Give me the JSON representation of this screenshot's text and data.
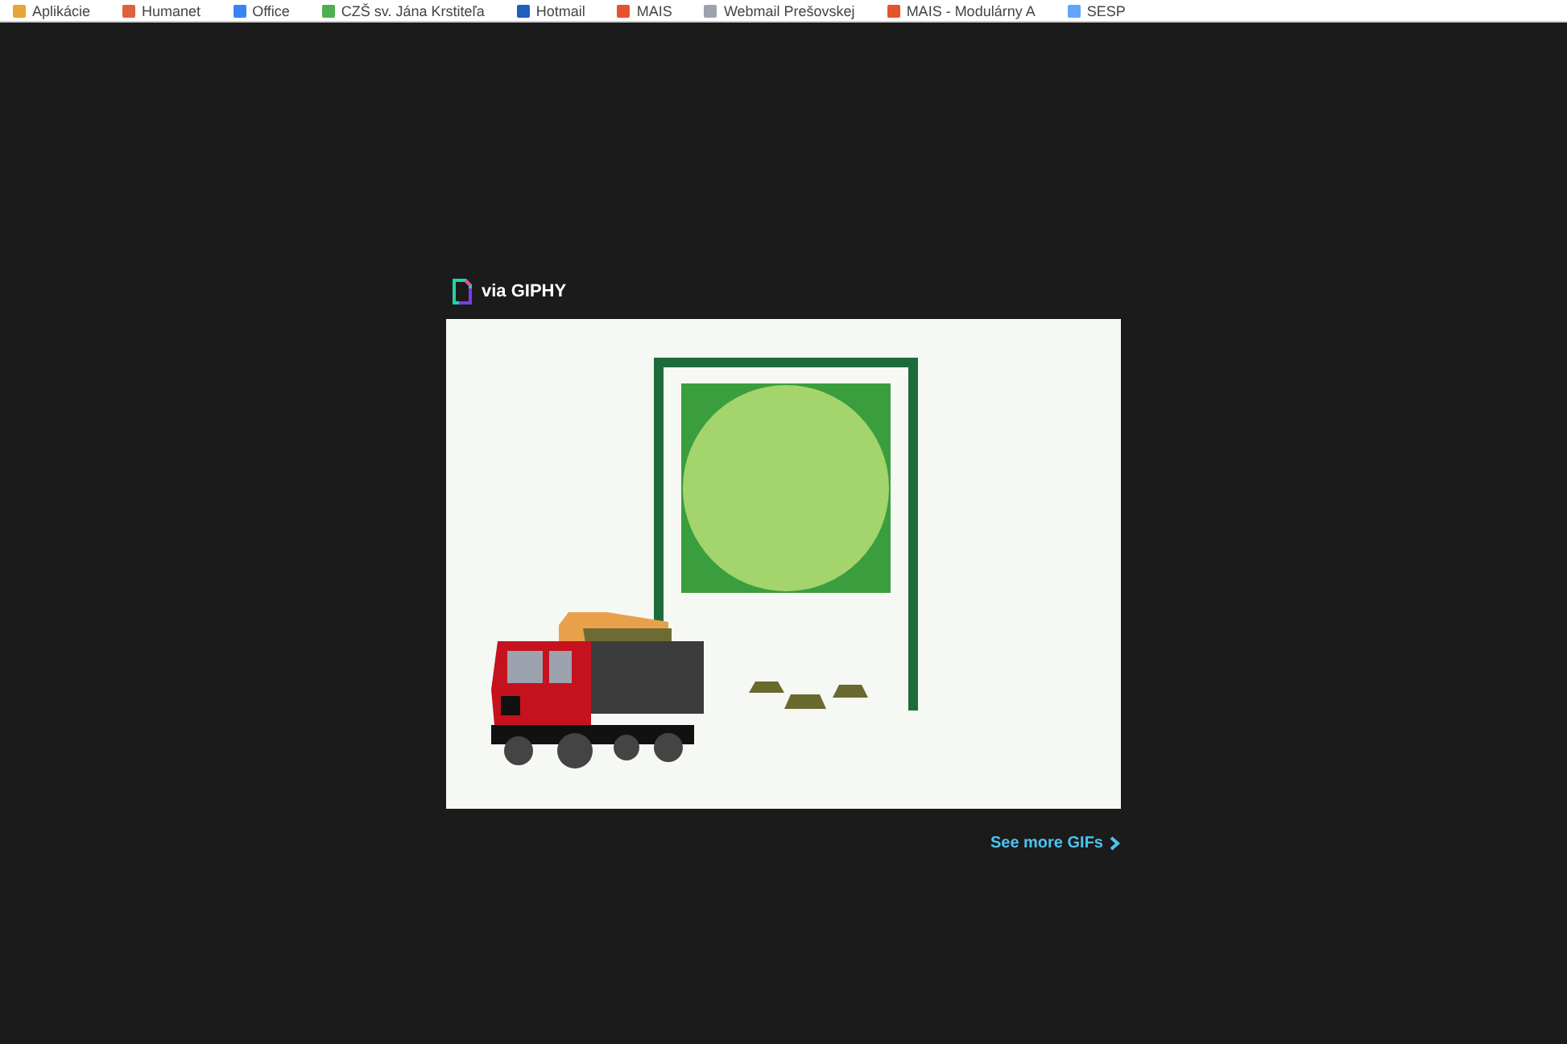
{
  "bookmarks": [
    {
      "label": "Aplikácie",
      "color": "#e8a33c"
    },
    {
      "label": "Humanet",
      "color": "#e0623a"
    },
    {
      "label": "Office",
      "color": "#3b82f6"
    },
    {
      "label": "CZŠ sv. Jána Krstiteľa",
      "color": "#4caf50"
    },
    {
      "label": "Hotmail",
      "color": "#1e5fbf"
    },
    {
      "label": "MAIS",
      "color": "#e5532d"
    },
    {
      "label": "Webmail Prešovskej",
      "color": "#9ca3af"
    },
    {
      "label": "MAIS - Modulárny A",
      "color": "#e5532d"
    },
    {
      "label": "SESP",
      "color": "#60a5fa"
    }
  ],
  "embed": {
    "attribution": "via GIPHY",
    "link": "See more GIFs"
  }
}
